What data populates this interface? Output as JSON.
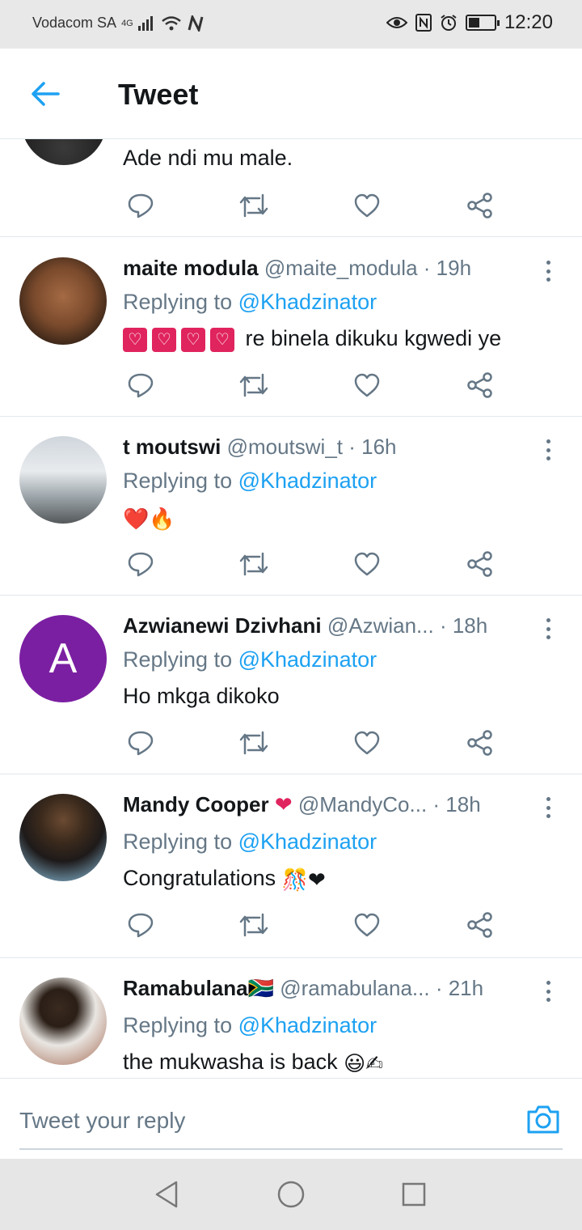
{
  "status_bar": {
    "carrier": "Vodacom SA",
    "network": "4G",
    "time": "12:20",
    "battery_level": 0.45
  },
  "header": {
    "title": "Tweet",
    "back_icon": "arrow-left-icon"
  },
  "partial_tweet": {
    "text": "Ade ndi mu male."
  },
  "tweets": [
    {
      "name": "maite modula",
      "handle": "@maite_modula",
      "time": "· 19h",
      "replying_prefix": "Replying to",
      "replying_to": "@Khadzinator",
      "text": "re binela dikuku kgwedi ye",
      "emoji": "",
      "avatar_letter": ""
    },
    {
      "name": "t moutswi",
      "handle": "@moutswi_t",
      "time": "· 16h",
      "replying_prefix": "Replying to",
      "replying_to": "@Khadzinator",
      "text": "",
      "emoji": "❤️🔥",
      "avatar_letter": ""
    },
    {
      "name": "Azwianewi Dzivhani",
      "handle": "@Azwian...",
      "time": "· 18h",
      "replying_prefix": "Replying to",
      "replying_to": "@Khadzinator",
      "text": "Ho mkga dikoko",
      "emoji": "",
      "avatar_letter": "A"
    },
    {
      "name": "Mandy Cooper",
      "name_emoji": "❤",
      "handle": "@MandyCo...",
      "time": "· 18h",
      "replying_prefix": "Replying to",
      "replying_to": "@Khadzinator",
      "text": "Congratulations",
      "emoji": "🎊❤",
      "avatar_letter": ""
    },
    {
      "name": "Ramabulana",
      "name_emoji": "🇿🇦",
      "handle": "@ramabulana...",
      "time": "· 21h",
      "replying_prefix": "Replying to",
      "replying_to": "@Khadzinator",
      "text": "the mukwasha is back",
      "emoji": "😃✍",
      "avatar_letter": ""
    }
  ],
  "reply_bar": {
    "placeholder": "Tweet your reply"
  },
  "colors": {
    "accent": "#1da1f2",
    "secondary_text": "#657786",
    "heart": "#e0245e"
  }
}
